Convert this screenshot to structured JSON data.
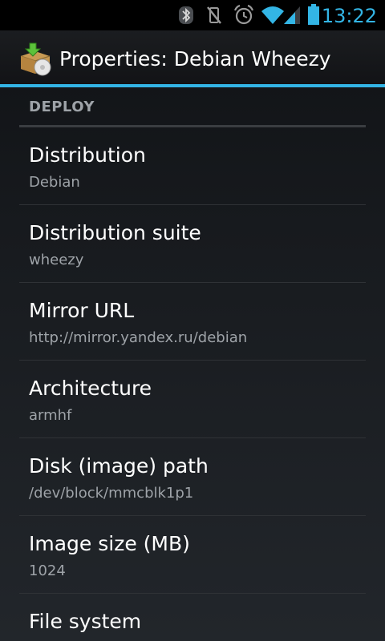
{
  "status_bar": {
    "time": "13:22",
    "icons": [
      "bluetooth-icon",
      "vibrate-off-icon",
      "alarm-icon",
      "wifi-icon",
      "signal-icon",
      "battery-icon"
    ],
    "accent_color": "#33b5e5"
  },
  "action_bar": {
    "icon": "package-install-icon",
    "title": "Properties: Debian Wheezy"
  },
  "section": {
    "header": "DEPLOY"
  },
  "preferences": [
    {
      "title": "Distribution",
      "summary": "Debian"
    },
    {
      "title": "Distribution suite",
      "summary": "wheezy"
    },
    {
      "title": "Mirror URL",
      "summary": "http://mirror.yandex.ru/debian"
    },
    {
      "title": "Architecture",
      "summary": "armhf"
    },
    {
      "title": "Disk (image) path",
      "summary": "/dev/block/mmcblk1p1"
    },
    {
      "title": "Image size (MB)",
      "summary": "1024"
    },
    {
      "title": "File system",
      "summary": ""
    }
  ]
}
